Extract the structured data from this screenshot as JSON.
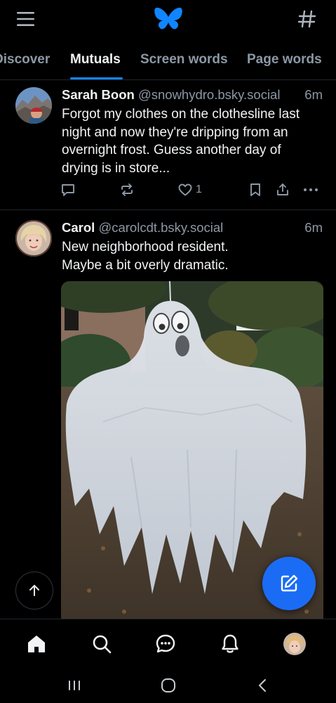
{
  "tabs": [
    "Discover",
    "Mutuals",
    "Screen words",
    "Page words"
  ],
  "active_tab": "Mutuals",
  "posts": [
    {
      "name": "Sarah Boon",
      "handle": "@snowhydro.bsky.social",
      "time": "6m",
      "lines": [
        "Forgot my clothes on the clothesline last",
        "night and now they're dripping from an",
        "overnight frost. Guess another day of",
        "drying is in store..."
      ],
      "like_count": "1"
    },
    {
      "name": "Carol",
      "handle": "@carolcdt.bsky.social",
      "time": "6m",
      "lines": [
        "New neighborhood resident.",
        "Maybe a bit overly dramatic."
      ]
    }
  ],
  "colors": {
    "accent": "#1185fe",
    "compose": "#1b6cf5",
    "muted_text": "#8d98a5",
    "background": "#000000"
  },
  "icons": {
    "top_left": "hamburger-menu-icon",
    "top_center": "butterfly-logo-icon",
    "top_right": "hashtag-feeds-icon",
    "nav": [
      "home-icon",
      "search-icon",
      "chat-icon",
      "bell-icon",
      "profile-avatar"
    ]
  }
}
